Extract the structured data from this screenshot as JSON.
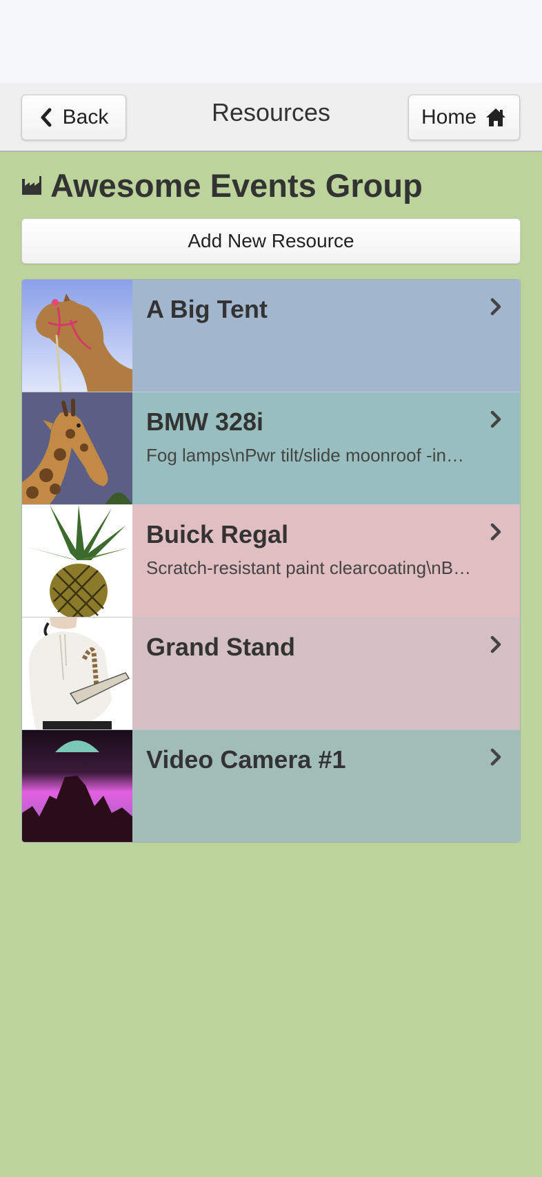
{
  "nav": {
    "title": "Resources",
    "back_label": "Back",
    "home_label": "Home"
  },
  "group": {
    "title": "Awesome Events Group"
  },
  "add_button_label": "Add New Resource",
  "resources": [
    {
      "title": "A Big Tent",
      "subtitle": "",
      "bg": "#a2b6ce",
      "image": "camel"
    },
    {
      "title": "BMW 328i",
      "subtitle": "Fog lamps\\nPwr tilt/slide moonroof -in…",
      "bg": "#99bec0",
      "image": "giraffe"
    },
    {
      "title": "Buick Regal",
      "subtitle": "Scratch-resistant paint clearcoating\\nB…",
      "bg": "#e0bec2",
      "image": "pineapple"
    },
    {
      "title": "Grand Stand",
      "subtitle": "",
      "bg": "#d4c0c2",
      "image": "writer"
    },
    {
      "title": "Video Camera #1",
      "subtitle": "",
      "bg": "#a2bcb8",
      "image": "moon-landscape"
    }
  ],
  "colors": {
    "page_bg": "#bcd49c",
    "navbar_bg": "#efefef"
  }
}
